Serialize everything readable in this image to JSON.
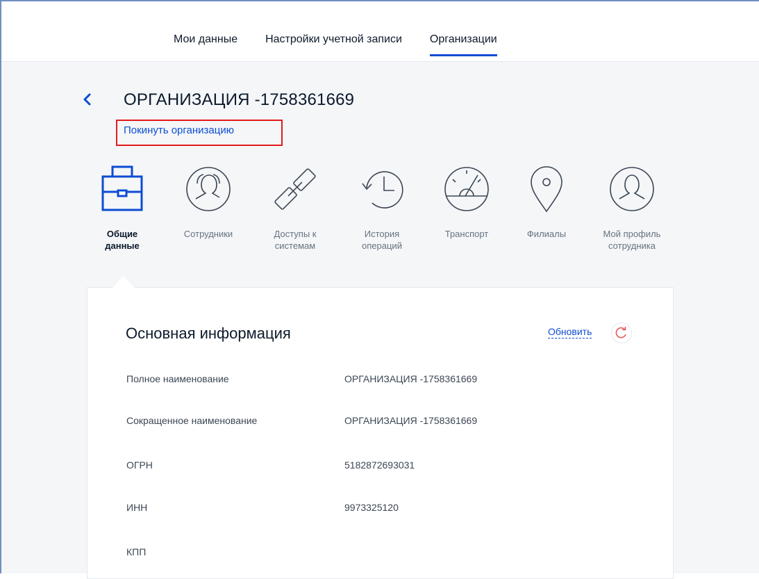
{
  "nav": {
    "tabs": [
      {
        "label": "Мои данные"
      },
      {
        "label": "Настройки учетной записи"
      },
      {
        "label": "Организации"
      }
    ]
  },
  "org": {
    "title": "ОРГАНИЗАЦИЯ -1758361669",
    "leave_link": "Покинуть организацию"
  },
  "sections": [
    {
      "label": "Общие\nданные",
      "icon": "briefcase-icon"
    },
    {
      "label": "Сотрудники",
      "icon": "employees-icon"
    },
    {
      "label": "Доступы к\nсистемам",
      "icon": "link-icon"
    },
    {
      "label": "История\nопераций",
      "icon": "history-icon"
    },
    {
      "label": "Транспорт",
      "icon": "speedometer-icon"
    },
    {
      "label": "Филиалы",
      "icon": "location-pin-icon"
    },
    {
      "label": "Мой профиль\nсотрудника",
      "icon": "profile-icon"
    }
  ],
  "info": {
    "title": "Основная информация",
    "refresh_label": "Обновить",
    "rows": [
      {
        "label": "Полное наименование",
        "value": "ОРГАНИЗАЦИЯ -1758361669"
      },
      {
        "label": "Сокращенное наименование",
        "value": "ОРГАНИЗАЦИЯ -1758361669"
      },
      {
        "label": "ОГРН",
        "value": "5182872693031"
      },
      {
        "label": "ИНН",
        "value": "9973325120"
      },
      {
        "label": "КПП",
        "value": ""
      }
    ]
  },
  "colors": {
    "accent": "#0d4cd3",
    "highlight_box": "#e21a1a",
    "refresh_icon": "#e8595a"
  }
}
